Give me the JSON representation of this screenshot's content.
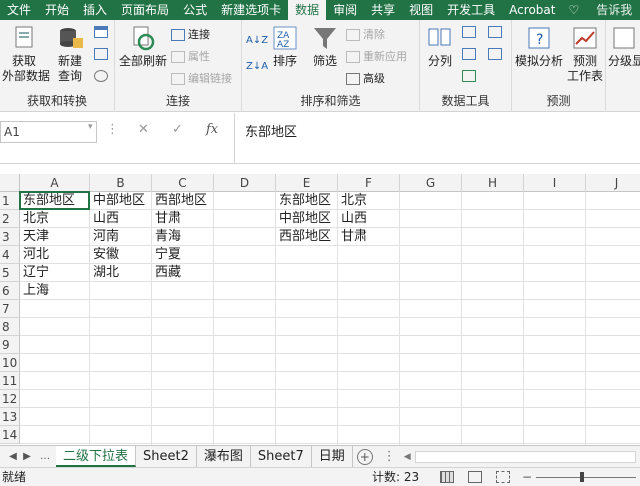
{
  "tabs": [
    "文件",
    "开始",
    "插入",
    "页面布局",
    "公式",
    "新建选项卡",
    "数据",
    "审阅",
    "共享",
    "视图",
    "开发工具",
    "Acrobat",
    "告诉我"
  ],
  "active_tab": "数据",
  "ribbon": {
    "get_data": "获取\n外部数据",
    "new_query": "新建\n查询",
    "group1": "获取和转换",
    "refresh_all": "全部刷新",
    "connections": "连接",
    "properties": "属性",
    "edit_links": "编辑链接",
    "group2": "连接",
    "sort": "排序",
    "filter": "筛选",
    "clear": "清除",
    "reapply": "重新应用",
    "advanced": "高级",
    "group3": "排序和筛选",
    "split": "分列",
    "group4": "数据工具",
    "whatif": "模拟分析",
    "forecast": "预测\n工作表",
    "group5": "预测",
    "outline": "分级显"
  },
  "namebox": "A1",
  "formula": "东部地区",
  "columns": [
    "A",
    "B",
    "C",
    "D",
    "E",
    "F",
    "G",
    "H",
    "I",
    "J"
  ],
  "rows": [
    "1",
    "2",
    "3",
    "4",
    "5",
    "6",
    "7",
    "8",
    "9",
    "10",
    "11",
    "12",
    "13",
    "14"
  ],
  "cells": {
    "A1": "东部地区",
    "B1": "中部地区",
    "C1": "西部地区",
    "E1": "东部地区",
    "F1": "北京",
    "A2": "北京",
    "B2": "山西",
    "C2": "甘肃",
    "E2": "中部地区",
    "F2": "山西",
    "A3": "天津",
    "B3": "河南",
    "C3": "青海",
    "E3": "西部地区",
    "F3": "甘肃",
    "A4": "河北",
    "B4": "安徽",
    "C4": "宁夏",
    "A5": "辽宁",
    "B5": "湖北",
    "C5": "西藏",
    "A6": "上海"
  },
  "sheets": [
    "二级下拉表",
    "Sheet2",
    "瀑布图",
    "Sheet7",
    "日期"
  ],
  "active_sheet": "二级下拉表",
  "status": {
    "ready": "就绪",
    "count": "计数: 23"
  },
  "colors": {
    "accent": "#217346"
  }
}
